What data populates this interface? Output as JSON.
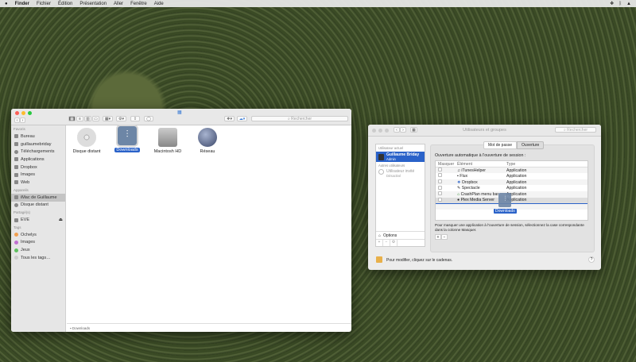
{
  "menubar": {
    "apple": "",
    "items": [
      "Finder",
      "Fichier",
      "Édition",
      "Présentation",
      "Aller",
      "Fenêtre",
      "Aide"
    ],
    "right_icons": [
      "dropbox-icon",
      "bluetooth-icon",
      "airplay-icon"
    ]
  },
  "finder": {
    "search_placeholder": "Rechercher",
    "sidebar": {
      "favoris_label": "Favoris",
      "favoris": [
        "Bureau",
        "guillaumebriday",
        "Téléchargements",
        "Applications",
        "Dropbox",
        "Images",
        "Web"
      ],
      "appareils_label": "Appareils",
      "appareils": [
        "iMac de Guillaume",
        "Disque distant"
      ],
      "partages_label": "Partagé(s)",
      "partages": [
        "EVE"
      ],
      "tags_label": "Tags",
      "tags": [
        {
          "label": "Ochelys",
          "color": "#f0a050"
        },
        {
          "label": "Images",
          "color": "#c070d0"
        },
        {
          "label": "Jeux",
          "color": "#60c060"
        },
        {
          "label": "Tous les tags…",
          "color": "#ccc"
        }
      ]
    },
    "items": [
      {
        "label": "Disque distant",
        "selected": false
      },
      {
        "label": "Downloads",
        "selected": true
      },
      {
        "label": "Macintosh HD",
        "selected": false
      },
      {
        "label": "Réseau",
        "selected": false
      }
    ],
    "status": "Downloads"
  },
  "users": {
    "title": "Utilisateurs et groupes",
    "search_placeholder": "Rechercher",
    "current_label": "Utilisateur actuel",
    "current_name": "Guillaume Briday",
    "current_role": "Admin",
    "others_label": "Autres utilisateurs",
    "guest_name": "Utilisateur invité",
    "guest_status": "Désactivé",
    "options": "Options",
    "tabs": [
      "Mot de passe",
      "Ouverture"
    ],
    "heading": "Ouverture automatique à l'ouverture de session :",
    "columns": [
      "Masquer",
      "Élément",
      "Type"
    ],
    "rows": [
      [
        "iTunesHelper",
        "Application"
      ],
      [
        "Flux",
        "Application"
      ],
      [
        "Dropbox",
        "Application"
      ],
      [
        "Spectacle",
        "Application"
      ],
      [
        "CrashPlan menu bar",
        "Application"
      ],
      [
        "Plex Media Server",
        "Application"
      ]
    ],
    "drag_label": "Downloads",
    "hint": "Pour masquer une application à l'ouverture de session, sélectionnez la case correspondante dans la colonne Masquer.",
    "lock_text": "Pour modifier, cliquez sur le cadenas.",
    "help": "?"
  }
}
